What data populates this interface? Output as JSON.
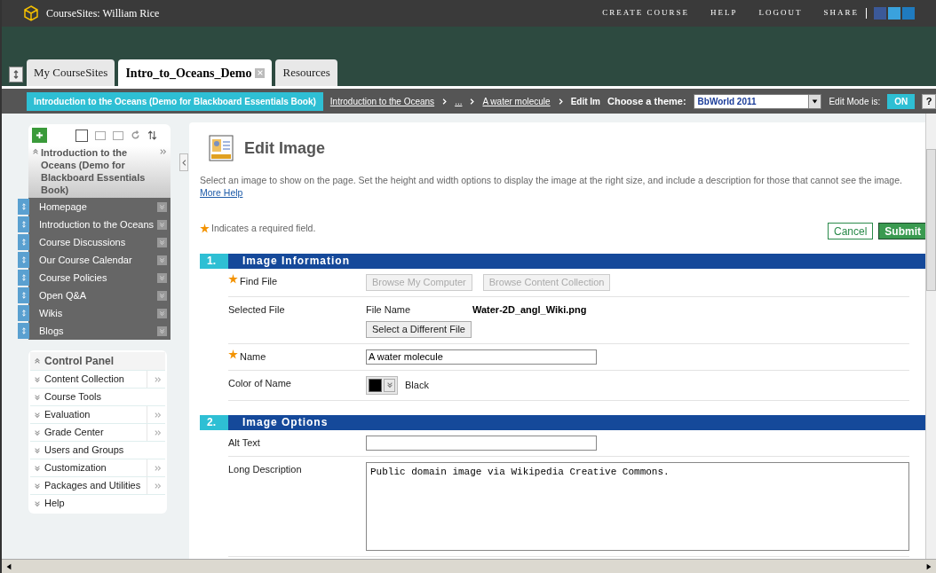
{
  "header": {
    "title": "CourseSites: William Rice",
    "links": [
      "CREATE COURSE",
      "HELP",
      "LOGOUT",
      "SHARE"
    ]
  },
  "tabs": [
    {
      "label": "My CourseSites",
      "selected": false,
      "closable": false
    },
    {
      "label": "Intro_to_Oceans_Demo",
      "selected": true,
      "closable": true
    },
    {
      "label": "Resources",
      "selected": false,
      "closable": false
    }
  ],
  "breadcrumb": {
    "course": "Introduction to the Oceans (Demo for Blackboard Essentials Book)",
    "items": [
      "Introduction to the Oceans",
      "...",
      "A water molecule"
    ],
    "current": "Edit Im"
  },
  "theme": {
    "label": "Choose a theme:",
    "value": "BbWorld 2011"
  },
  "edit_mode": {
    "label": "Edit Mode is:",
    "value": "ON",
    "on": true,
    "help": "?"
  },
  "course_menu": {
    "title": "Introduction to the Oceans (Demo for Blackboard Essentials Book)",
    "items": [
      "Homepage",
      "Introduction to the Oceans",
      "Course Discussions",
      "Our Course Calendar",
      "Course Policies",
      "Open Q&A",
      "Wikis",
      "Blogs"
    ]
  },
  "control_panel": {
    "title": "Control Panel",
    "items": [
      {
        "label": "Content Collection",
        "has_submenu": true
      },
      {
        "label": "Course Tools",
        "has_submenu": false
      },
      {
        "label": "Evaluation",
        "has_submenu": true
      },
      {
        "label": "Grade Center",
        "has_submenu": true
      },
      {
        "label": "Users and Groups",
        "has_submenu": false
      },
      {
        "label": "Customization",
        "has_submenu": true
      },
      {
        "label": "Packages and Utilities",
        "has_submenu": true
      },
      {
        "label": "Help",
        "has_submenu": false
      }
    ]
  },
  "page": {
    "title": "Edit Image",
    "description": "Select an image to show on the page. Set the height and width options to display the image at the right size, and include a description for those that cannot see the image.",
    "more_help": "More Help",
    "required_note": "Indicates a required field.",
    "cancel": "Cancel",
    "submit": "Submit",
    "sections": [
      {
        "number": "1.",
        "title": "Image Information",
        "rows": [
          {
            "kind": "buttons",
            "label": "Find File",
            "required": true,
            "buttons": [
              {
                "label": "Browse My Computer",
                "disabled": true
              },
              {
                "label": "Browse Content Collection",
                "disabled": true
              }
            ]
          },
          {
            "kind": "file",
            "label": "Selected File",
            "required": false,
            "file_label": "File Name",
            "file_name": "Water-2D_angl_Wiki.png",
            "button": "Select a Different File"
          },
          {
            "kind": "text",
            "label": "Name",
            "required": true,
            "value": "A water molecule"
          },
          {
            "kind": "color",
            "label": "Color of Name",
            "required": false,
            "color": "#000000",
            "color_name": "Black"
          }
        ]
      },
      {
        "number": "2.",
        "title": "Image Options",
        "rows": [
          {
            "kind": "text",
            "label": "Alt Text",
            "required": false
          },
          {
            "kind": "textarea",
            "label": "Long Description",
            "required": false,
            "value": "Public domain image via Wikipedia Creative Commons."
          }
        ]
      }
    ]
  }
}
